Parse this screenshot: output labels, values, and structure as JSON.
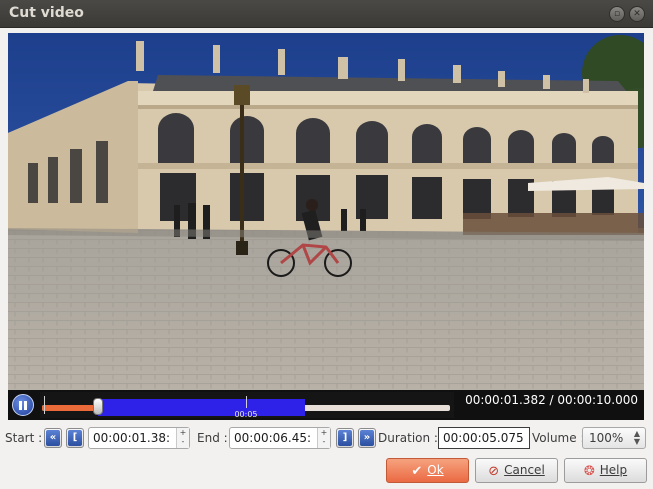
{
  "window": {
    "title": "Cut video",
    "buttons": [
      "minimize-icon",
      "close-icon"
    ]
  },
  "player": {
    "state_icon": "pause-icon",
    "timecode": "00:00:01.382 / 00:00:10.000",
    "tick_label": "00:05",
    "position_fraction": 0.138,
    "selection_start_fraction": 0.138,
    "selection_end_fraction": 0.645
  },
  "cut": {
    "start_label": "Start :",
    "start_value": "00:00:01.38:",
    "end_label": "End :",
    "end_value": "00:00:06.45:",
    "duration_label": "Duration :",
    "duration_value": "00:00:05.075",
    "volume_label": "Volume :",
    "volume_value": "100%"
  },
  "dialog_buttons": {
    "ok_label": "Ok",
    "cancel_label": "Cancel",
    "help_label": "Help"
  },
  "colors": {
    "accent_ok": "#ea6a43",
    "selection": "#2e22e8",
    "played": "#ea6a3a"
  }
}
